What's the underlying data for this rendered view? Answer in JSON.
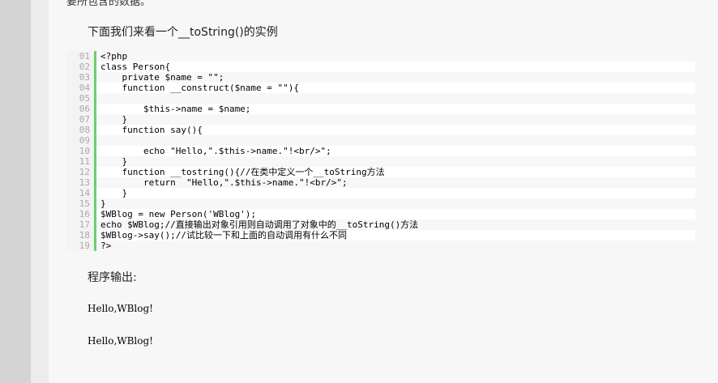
{
  "cut_text": "要所包含的数据。",
  "intro_text": "下面我们来看一个__toString()的实例",
  "code": {
    "lines": [
      {
        "num": "01",
        "text": "<?php"
      },
      {
        "num": "02",
        "text": "class Person{"
      },
      {
        "num": "03",
        "text": "    private $name = \"\";"
      },
      {
        "num": "04",
        "text": "    function __construct($name = \"\"){"
      },
      {
        "num": "05",
        "text": ""
      },
      {
        "num": "06",
        "text": "        $this->name = $name;"
      },
      {
        "num": "07",
        "text": "    }"
      },
      {
        "num": "08",
        "text": "    function say(){"
      },
      {
        "num": "09",
        "text": ""
      },
      {
        "num": "10",
        "text": "        echo \"Hello,\".$this->name.\"!<br/>\";"
      },
      {
        "num": "11",
        "text": "    }"
      },
      {
        "num": "12",
        "text": "    function __tostring(){//在类中定义一个__toString方法"
      },
      {
        "num": "13",
        "text": "        return  \"Hello,\".$this->name.\"!<br/>\";"
      },
      {
        "num": "14",
        "text": "    }"
      },
      {
        "num": "15",
        "text": "}"
      },
      {
        "num": "16",
        "text": "$WBlog = new Person('WBlog');"
      },
      {
        "num": "17",
        "text": "echo $WBlog;//直接输出对象引用则自动调用了对象中的__toString()方法"
      },
      {
        "num": "18",
        "text": "$WBlog->say();//试比较一下和上面的自动调用有什么不同"
      },
      {
        "num": "19",
        "text": "?>"
      }
    ]
  },
  "output_label": "程序输出:",
  "output_lines": [
    "Hello,WBlog!",
    "Hello,WBlog!"
  ],
  "colors": {
    "gutter_bar": "#6ccf6c",
    "keyword": "#0000ff",
    "variable": "#b8860b",
    "string": "#0000ff",
    "comment": "#008000"
  }
}
